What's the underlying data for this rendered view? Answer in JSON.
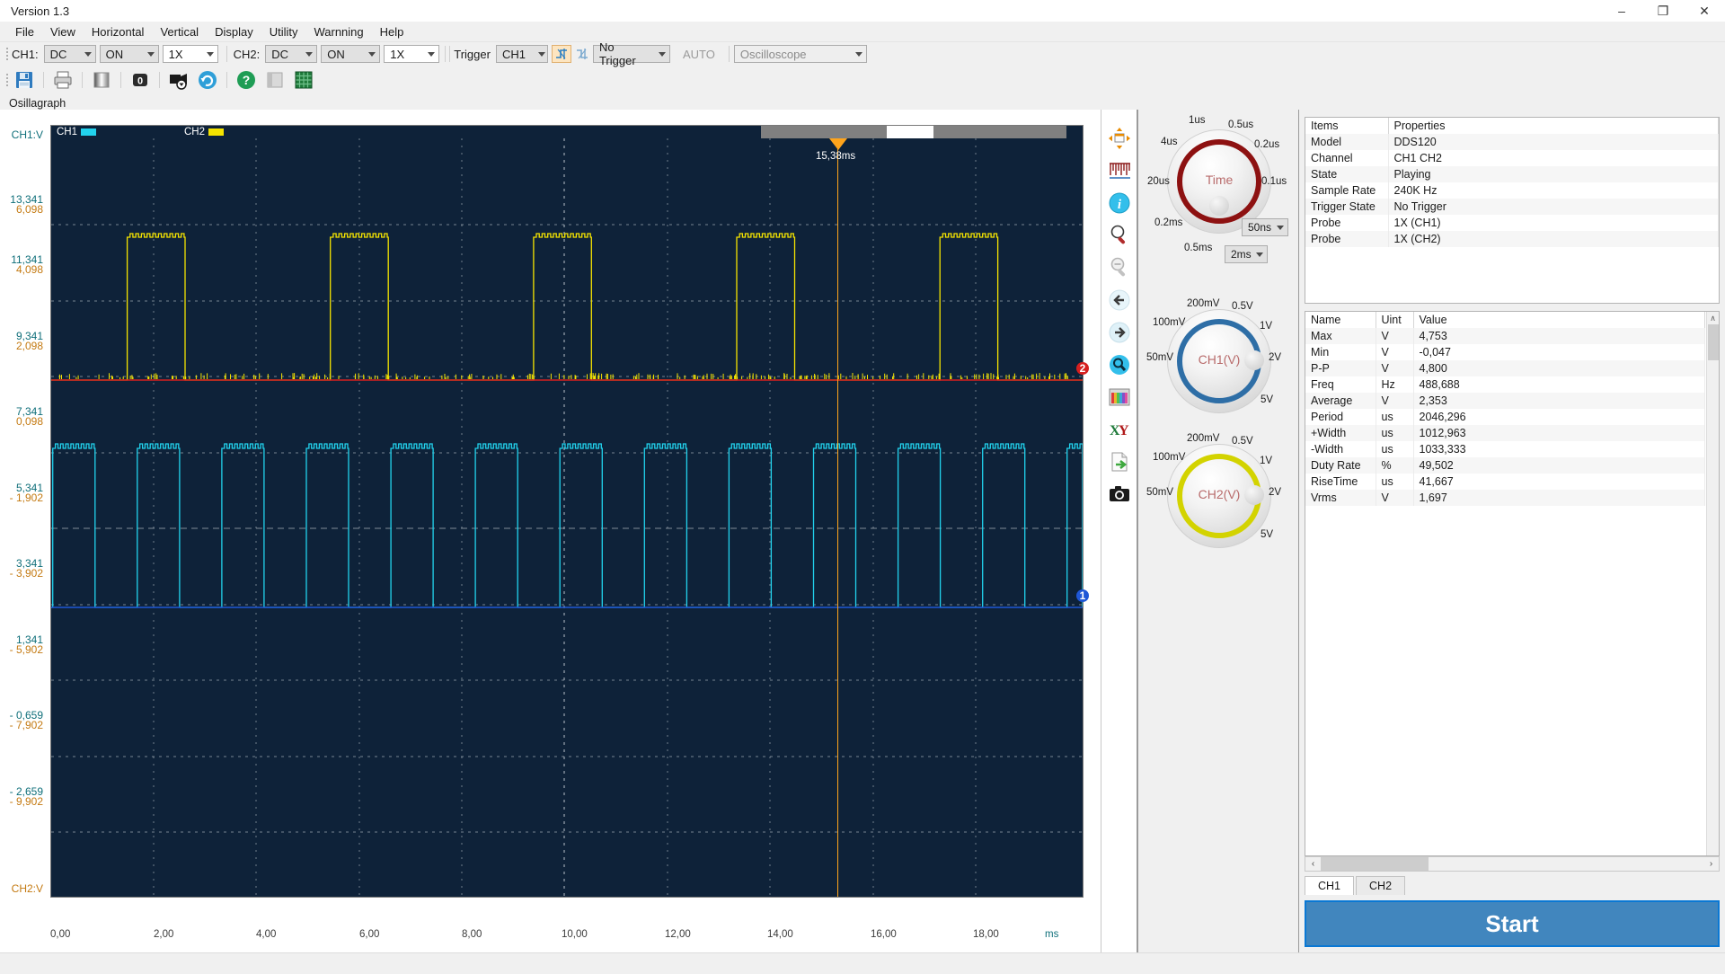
{
  "window": {
    "title": "Version 1.3",
    "minimize": "–",
    "maximize": "❐",
    "close": "✕"
  },
  "menubar": {
    "items": [
      "File",
      "View",
      "Horizontal",
      "Vertical",
      "Display",
      "Utility",
      "Warnning",
      "Help"
    ]
  },
  "settings": {
    "ch1_label": "CH1:",
    "ch1_coupling": "DC",
    "ch1_state": "ON",
    "ch1_probe": "1X",
    "ch2_label": "CH2:",
    "ch2_coupling": "DC",
    "ch2_state": "ON",
    "ch2_probe": "1X",
    "trigger_label": "Trigger",
    "trigger_source": "CH1",
    "trigger_mode": "No Trigger",
    "auto_label": "AUTO",
    "device": "Oscilloscope"
  },
  "tabstrip": {
    "tab": "Osillagraph"
  },
  "plot": {
    "legend": [
      {
        "name": "CH1",
        "color": "#22d3ee"
      },
      {
        "name": "CH2",
        "color": "#f5e400"
      }
    ],
    "trigger_time": "15,38ms",
    "cursor1": "1",
    "cursor2": "2",
    "y_unit_top": "CH1:V",
    "y_unit_bottom": "CH2:V",
    "x_unit": "ms",
    "x_ticks": [
      "0,00",
      "2,00",
      "4,00",
      "6,00",
      "8,00",
      "10,00",
      "12,00",
      "14,00",
      "16,00",
      "18,00"
    ],
    "y_ticks_ch1": [
      "13,341",
      "11,341",
      "9,341",
      "7,341",
      "5,341",
      "3,341",
      "1,341",
      "- 0,659",
      "- 2,659"
    ],
    "y_ticks_ch2": [
      "6,098",
      "4,098",
      "2,098",
      "0,098",
      "- 1,902",
      "- 3,902",
      "- 5,902",
      "- 7,902",
      "- 9,902"
    ]
  },
  "rail": {
    "icons": [
      "move-icon",
      "ruler-icon",
      "info-icon",
      "zoom-in-icon",
      "zoom-out-icon",
      "arrow-left-icon",
      "arrow-right-icon",
      "search-icon",
      "color-palette-icon",
      "xy-mode-icon",
      "export-icon",
      "camera-icon"
    ]
  },
  "toolbar": {
    "icons": [
      "save-icon",
      "print-icon",
      "gradient-icon",
      "zero-icon",
      "record-icon",
      "refresh-icon",
      "help-icon",
      "panel-icon",
      "grid-icon"
    ],
    "zero_label": "0"
  },
  "knobs": {
    "time": {
      "title": "Time",
      "ticks": [
        "1us",
        "0.5us",
        "4us",
        "0.2us",
        "20us",
        "0.1us",
        "0.2ms",
        "0.5ms"
      ],
      "select_main": "2ms",
      "select_fine": "50ns",
      "ring_color": "#a30f0f"
    },
    "ch1": {
      "title": "CH1(V)",
      "ticks": [
        "200mV",
        "0.5V",
        "100mV",
        "1V",
        "50mV",
        "2V",
        "5V"
      ],
      "ring_color": "#2e6ea6"
    },
    "ch2": {
      "title": "CH2(V)",
      "ticks": [
        "200mV",
        "0.5V",
        "100mV",
        "1V",
        "50mV",
        "2V",
        "5V"
      ],
      "ring_color": "#d6d600"
    }
  },
  "properties": {
    "headers": [
      "Items",
      "Properties"
    ],
    "rows": [
      [
        "Model",
        "DDS120"
      ],
      [
        "Channel",
        "CH1 CH2"
      ],
      [
        "State",
        "Playing"
      ],
      [
        "Sample Rate",
        "240K Hz"
      ],
      [
        "Trigger State",
        "No Trigger"
      ],
      [
        "Probe",
        "1X (CH1)"
      ],
      [
        "Probe",
        "1X (CH2)"
      ]
    ]
  },
  "measurements": {
    "headers": [
      "Name",
      "Uint",
      "Value"
    ],
    "rows": [
      [
        "Max",
        "V",
        "4,753"
      ],
      [
        "Min",
        "V",
        "-0,047"
      ],
      [
        "P-P",
        "V",
        "4,800"
      ],
      [
        "Freq",
        "Hz",
        "488,688"
      ],
      [
        "Average",
        "V",
        "2,353"
      ],
      [
        "Period",
        "us",
        "2046,296"
      ],
      [
        "+Width",
        "us",
        "1012,963"
      ],
      [
        "-Width",
        "us",
        "1033,333"
      ],
      [
        "Duty Rate",
        "%",
        "49,502"
      ],
      [
        "RiseTime",
        "us",
        "41,667"
      ],
      [
        "Vrms",
        "V",
        "1,697"
      ]
    ]
  },
  "channel_tabs": {
    "items": [
      "CH1",
      "CH2"
    ],
    "active": "CH1"
  },
  "start_button": {
    "label": "Start"
  },
  "scroll": {
    "left_arrow": "‹",
    "right_arrow": "›",
    "up_arrow": "∧",
    "down_arrow": "∨"
  },
  "chart_data": {
    "type": "line",
    "title": "Osillagraph — dual-channel square waves",
    "xlabel": "ms",
    "ylabel_ch1": "CH1:V",
    "ylabel_ch2": "CH2:V",
    "xlim": [
      -0.35,
      19.6
    ],
    "grid": true,
    "legend": [
      "CH1",
      "CH2"
    ],
    "series": [
      {
        "name": "CH2",
        "color": "#f5e400",
        "type": "square",
        "period_ms": 3.9,
        "duty": 0.28,
        "high_value": 12.0,
        "low_value": 7.34,
        "phase_ms": 1.1,
        "ylim": [
          -3.6,
          14.3
        ],
        "note": "5 visible pulses, noisy flat top"
      },
      {
        "name": "CH1",
        "color": "#22d3ee",
        "type": "square",
        "period_ms": 1.63,
        "duty": 0.5,
        "high_value": -0.05,
        "low_value": -0.66,
        "phase_ms": 0.0,
        "ylim": [
          -3.6,
          14.3
        ],
        "note": "12 visible pulses, noisy flat top"
      }
    ],
    "cursors": [
      {
        "id": "1",
        "color": "#1f57d6",
        "axis": "y",
        "value": -0.659
      },
      {
        "id": "2",
        "color": "#d61f1f",
        "axis": "y",
        "value": 7.341
      }
    ],
    "trigger": {
      "time_ms": 15.38,
      "label": "15,38ms",
      "color": "#ffa41b"
    }
  }
}
